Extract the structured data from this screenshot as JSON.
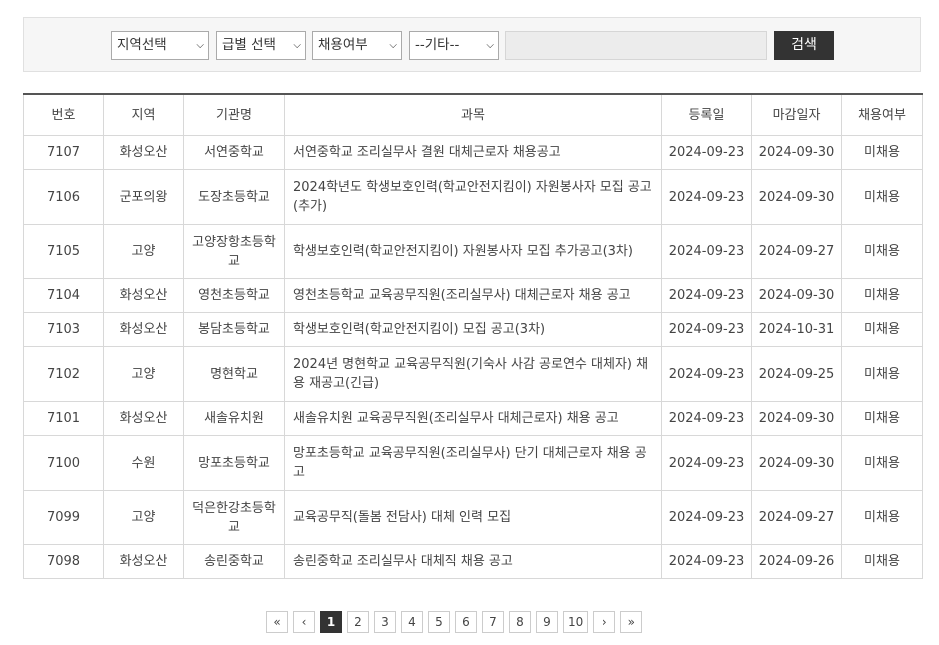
{
  "search": {
    "region_select": "지역선택",
    "grade_select": "급별 선택",
    "hire_select": "채용여부",
    "etc_select": "--기타--",
    "keyword_value": "",
    "button_label": "검색"
  },
  "table": {
    "headers": [
      "번호",
      "지역",
      "기관명",
      "과목",
      "등록일",
      "마감일자",
      "채용여부"
    ],
    "rows": [
      {
        "no": "7107",
        "region": "화성오산",
        "org": "서연중학교",
        "subject": "서연중학교 조리실무사 결원 대체근로자 채용공고",
        "reg": "2024-09-23",
        "deadline": "2024-09-30",
        "status": "미채용"
      },
      {
        "no": "7106",
        "region": "군포의왕",
        "org": "도장초등학교",
        "subject": "2024학년도 학생보호인력(학교안전지킴이) 자원봉사자 모집 공고(추가)",
        "reg": "2024-09-23",
        "deadline": "2024-09-30",
        "status": "미채용"
      },
      {
        "no": "7105",
        "region": "고양",
        "org": "고양장항초등학교",
        "subject": "학생보호인력(학교안전지킴이) 자원봉사자 모집 추가공고(3차)",
        "reg": "2024-09-23",
        "deadline": "2024-09-27",
        "status": "미채용"
      },
      {
        "no": "7104",
        "region": "화성오산",
        "org": "영천초등학교",
        "subject": "영천초등학교 교육공무직원(조리실무사) 대체근로자 채용 공고",
        "reg": "2024-09-23",
        "deadline": "2024-09-30",
        "status": "미채용"
      },
      {
        "no": "7103",
        "region": "화성오산",
        "org": "봉담초등학교",
        "subject": "학생보호인력(학교안전지킴이) 모집 공고(3차)",
        "reg": "2024-09-23",
        "deadline": "2024-10-31",
        "status": "미채용"
      },
      {
        "no": "7102",
        "region": "고양",
        "org": "명현학교",
        "subject": "2024년 명현학교 교육공무직원(기숙사 사감 공로연수 대체자) 채용 재공고(긴급)",
        "reg": "2024-09-23",
        "deadline": "2024-09-25",
        "status": "미채용"
      },
      {
        "no": "7101",
        "region": "화성오산",
        "org": "새솔유치원",
        "subject": "새솔유치원 교육공무직원(조리실무사 대체근로자) 채용 공고",
        "reg": "2024-09-23",
        "deadline": "2024-09-30",
        "status": "미채용"
      },
      {
        "no": "7100",
        "region": "수원",
        "org": "망포초등학교",
        "subject": "망포초등학교 교육공무직원(조리실무사) 단기 대체근로자 채용 공고",
        "reg": "2024-09-23",
        "deadline": "2024-09-30",
        "status": "미채용"
      },
      {
        "no": "7099",
        "region": "고양",
        "org": "덕은한강초등학교",
        "subject": "교육공무직(돌봄 전담사) 대체 인력 모집",
        "reg": "2024-09-23",
        "deadline": "2024-09-27",
        "status": "미채용"
      },
      {
        "no": "7098",
        "region": "화성오산",
        "org": "송린중학교",
        "subject": "송린중학교 조리실무사 대체직 채용 공고",
        "reg": "2024-09-23",
        "deadline": "2024-09-26",
        "status": "미채용"
      }
    ]
  },
  "pagination": {
    "first": "«",
    "prev": "‹",
    "pages": [
      "1",
      "2",
      "3",
      "4",
      "5",
      "6",
      "7",
      "8",
      "9",
      "10"
    ],
    "current": "1",
    "next": "›",
    "last": "»"
  }
}
